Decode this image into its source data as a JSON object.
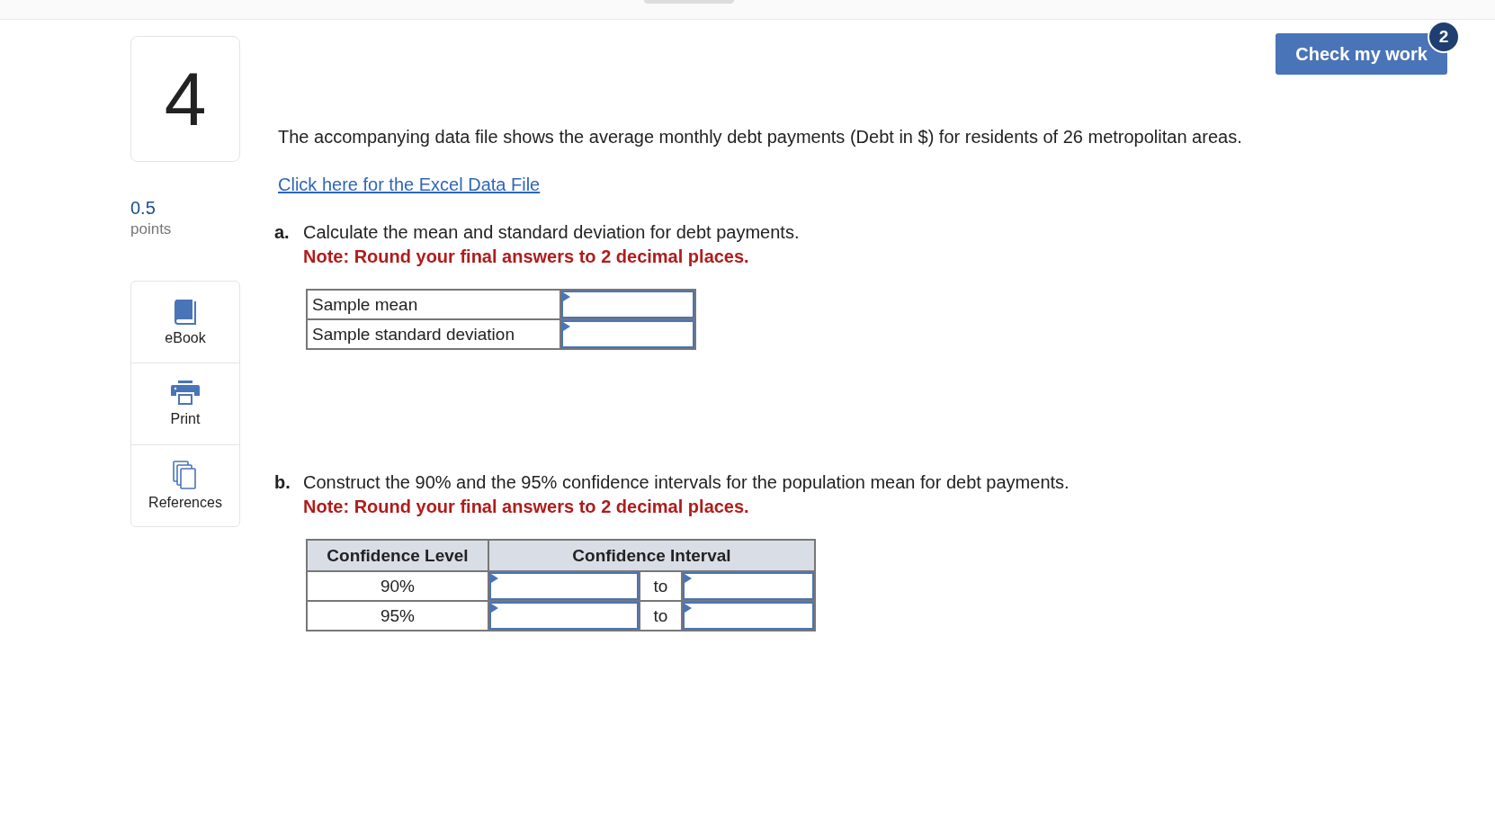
{
  "question_number": "4",
  "points": {
    "value": "0.5",
    "label": "points"
  },
  "tools": [
    {
      "kind": "book",
      "label": "eBook"
    },
    {
      "kind": "printer",
      "label": "Print"
    },
    {
      "kind": "copies",
      "label": "References"
    }
  ],
  "check_button": {
    "label": "Check my work",
    "badge": "2"
  },
  "intro": "The accompanying data file shows the average monthly debt payments (Debt in $) for residents of 26 metropolitan areas.",
  "data_link": "Click here for the Excel Data File",
  "part_a": {
    "letter": "a.",
    "question": "Calculate the mean and standard deviation for debt payments.",
    "note": "Note: Round your final answers to 2 decimal places.",
    "rows": [
      {
        "label": "Sample mean"
      },
      {
        "label": "Sample standard deviation"
      }
    ]
  },
  "part_b": {
    "letter": "b.",
    "question": "Construct the 90% and the 95% confidence intervals for the population mean for debt payments.",
    "note": "Note: Round your final answers to 2 decimal places.",
    "columns": [
      "Confidence Level",
      "Confidence Interval"
    ],
    "rows": [
      {
        "level": "90%",
        "separator": "to"
      },
      {
        "level": "95%",
        "separator": "to"
      }
    ]
  }
}
